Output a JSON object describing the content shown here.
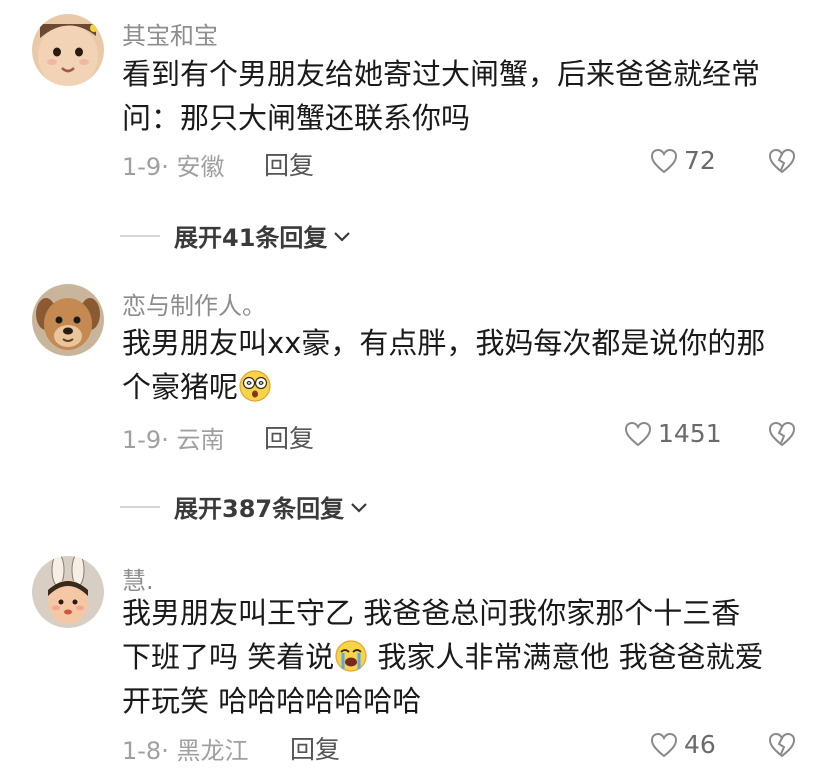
{
  "comments": [
    {
      "username": "其宝和宝",
      "lines": [
        "看到有个男朋友给她寄过大闸蟹，后来爸爸就经常",
        "问：那只大闸蟹还联系你吗"
      ],
      "date": "1-9",
      "location": "安徽",
      "reply_label": "回复",
      "likes": "72",
      "expand_label": "展开41条回复",
      "avatar_icon": "baby-face-avatar"
    },
    {
      "username": "恋与制作人。",
      "lines": [
        "我男朋友叫xx豪，有点胖，我妈每次都是说你的那",
        "个豪猪呢"
      ],
      "emoji": "dizzy-face-emoji",
      "date": "1-9",
      "location": "云南",
      "reply_label": "回复",
      "likes": "1451",
      "expand_label": "展开387条回复",
      "avatar_icon": "puppy-avatar"
    },
    {
      "username": "慧.",
      "lines": [
        "我男朋友叫王守乙 我爸爸总问我你家那个十三香",
        "下班了吗 笑着说",
        "开玩笑 哈哈哈哈哈哈哈"
      ],
      "line2_suffix": " 我家人非常满意他 我爸爸就爱",
      "emoji": "loudly-crying-face-emoji",
      "date": "1-8",
      "location": "黑龙江",
      "reply_label": "回复",
      "likes": "46",
      "avatar_icon": "bunny-ears-avatar"
    }
  ],
  "colors": {
    "meta": "#a0a0a0",
    "username": "#8d8d8d",
    "text": "#1a1a1a"
  }
}
